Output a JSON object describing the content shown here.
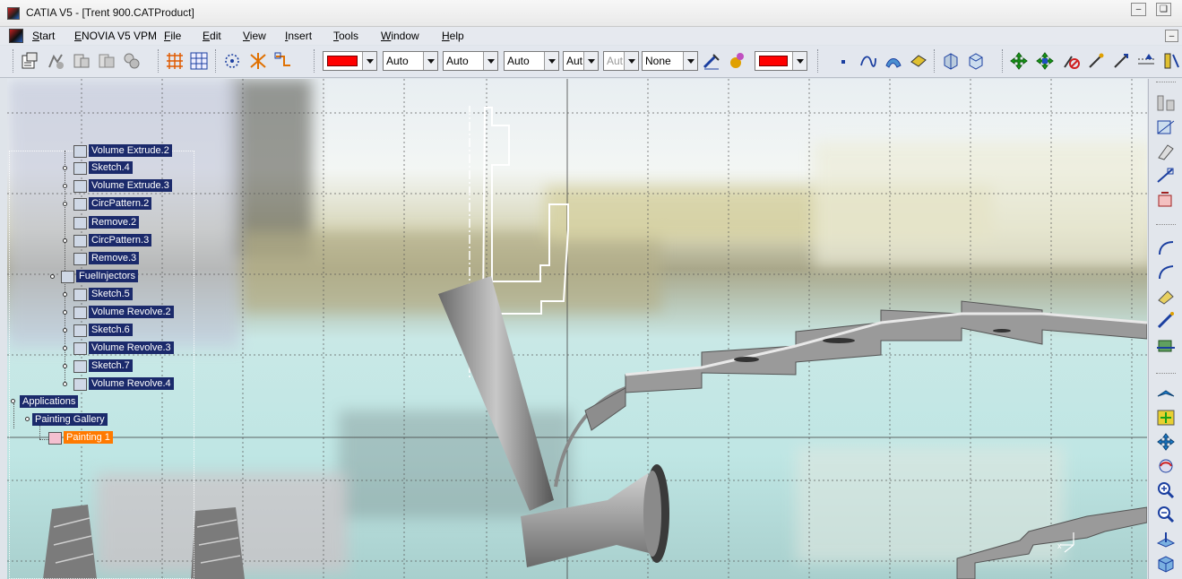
{
  "window": {
    "title": "CATIA V5 - [Trent 900.CATProduct]"
  },
  "menu": {
    "items": [
      "Start",
      "ENOVIA V5 VPM",
      "File",
      "Edit",
      "View",
      "Insert",
      "Tools",
      "Window",
      "Help"
    ]
  },
  "toolbar": {
    "color_combo": {
      "value": "",
      "color": "#ff0000"
    },
    "transparency_combo": {
      "value": "Auto"
    },
    "linetype_combo": {
      "value": "Auto"
    },
    "thickness_combo": {
      "value": "Auto"
    },
    "point_combo": {
      "value": "Aut"
    },
    "layer_combo": {
      "value": "Aut"
    },
    "render_combo": {
      "value": "None"
    },
    "fill_color_combo": {
      "value": "",
      "color": "#ff0000"
    }
  },
  "tree": {
    "nodes": [
      {
        "label": "Volume Extrude.2",
        "icon": "volume-extrude-icon"
      },
      {
        "label": "Sketch.4",
        "icon": "sketch-icon"
      },
      {
        "label": "Volume Extrude.3",
        "icon": "volume-extrude-icon"
      },
      {
        "label": "CircPattern.2",
        "icon": "circ-pattern-icon"
      },
      {
        "label": "Remove.2",
        "icon": "remove-icon"
      },
      {
        "label": "CircPattern.3",
        "icon": "circ-pattern-icon"
      },
      {
        "label": "Remove.3",
        "icon": "remove-icon"
      },
      {
        "label": "FuelInjectors",
        "icon": "body-icon"
      },
      {
        "label": "Sketch.5",
        "icon": "sketch-icon"
      },
      {
        "label": "Volume Revolve.2",
        "icon": "volume-revolve-icon"
      },
      {
        "label": "Sketch.6",
        "icon": "sketch-icon"
      },
      {
        "label": "Volume Revolve.3",
        "icon": "volume-revolve-icon"
      },
      {
        "label": "Sketch.7",
        "icon": "sketch-icon"
      },
      {
        "label": "Volume Revolve.4",
        "icon": "volume-revolve-icon"
      },
      {
        "label": "Applications",
        "icon": "applications-icon"
      },
      {
        "label": "Painting Gallery",
        "icon": "gallery-icon"
      },
      {
        "label": "Painting 1",
        "icon": "painting-icon",
        "selected": true
      }
    ]
  },
  "colors": {
    "accent_selected": "#ff7a00",
    "tree_label_bg": "#1b2a6b",
    "grid": "#555555"
  }
}
